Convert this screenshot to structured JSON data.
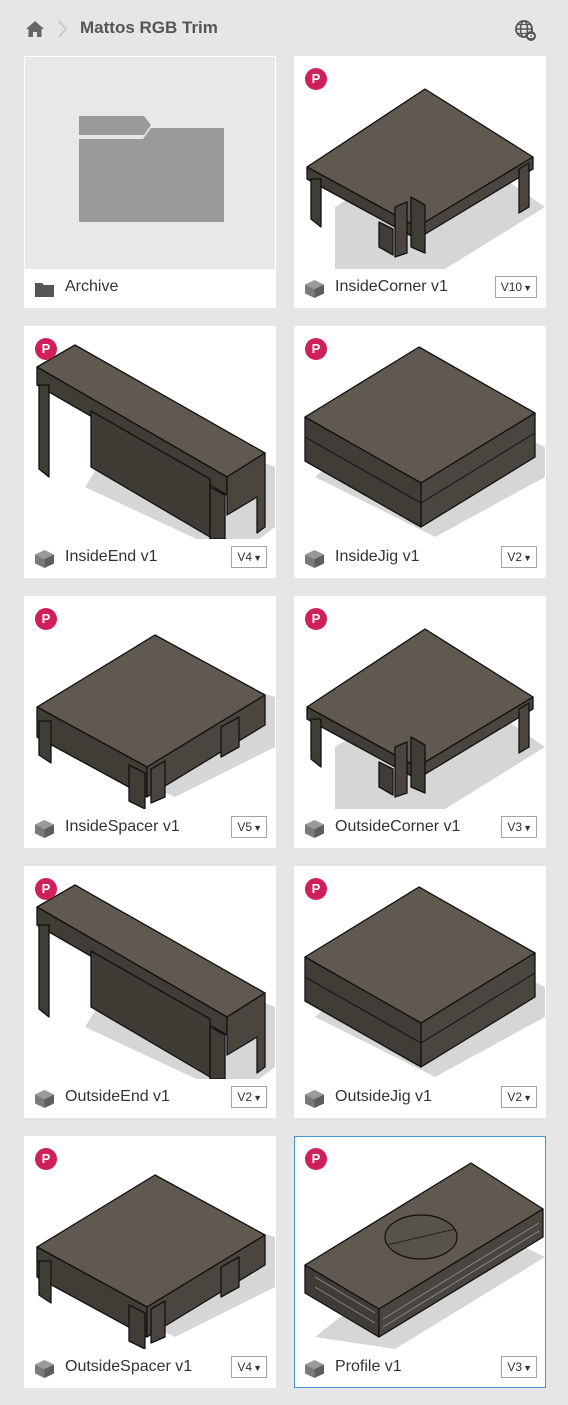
{
  "breadcrumb": {
    "title": "Mattos RGB Trim"
  },
  "badge_label": "P",
  "items": [
    {
      "name": "Archive",
      "kind": "folder"
    },
    {
      "name": "InsideCorner v1",
      "version": "V10",
      "shape": "corner"
    },
    {
      "name": "InsideEnd v1",
      "version": "V4",
      "shape": "end"
    },
    {
      "name": "InsideJig v1",
      "version": "V2",
      "shape": "jig"
    },
    {
      "name": "InsideSpacer v1",
      "version": "V5",
      "shape": "spacer"
    },
    {
      "name": "OutsideCorner v1",
      "version": "V3",
      "shape": "corner"
    },
    {
      "name": "OutsideEnd v1",
      "version": "V2",
      "shape": "end"
    },
    {
      "name": "OutsideJig v1",
      "version": "V2",
      "shape": "jig"
    },
    {
      "name": "OutsideSpacer v1",
      "version": "V4",
      "shape": "spacer"
    },
    {
      "name": "Profile v1",
      "version": "V3",
      "shape": "profile",
      "selected": true
    }
  ],
  "colors": {
    "badge": "#d0205a",
    "model_face": "#5f5950",
    "selected_border": "#4a90d9"
  }
}
